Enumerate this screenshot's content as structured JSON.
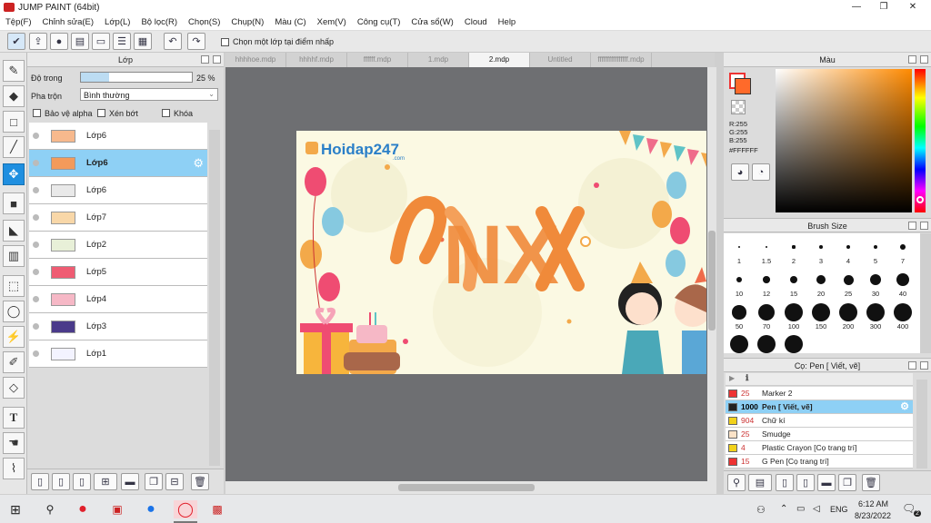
{
  "window": {
    "title": "JUMP PAINT (64bit)",
    "minimize": "—",
    "restore": "❐",
    "close": "✕"
  },
  "menu": [
    "Tệp(F)",
    "Chỉnh sửa(E)",
    "Lớp(L)",
    "Bộ lọc(R)",
    "Chọn(S)",
    "Chụp(N)",
    "Màu (C)",
    "Xem(V)",
    "Công cụ(T)",
    "Cửa sổ(W)",
    "Cloud",
    "Help"
  ],
  "toolbar": {
    "select_layer_label": "Chọn một lớp tại điểm nhấp"
  },
  "layers_panel": {
    "title": "Lớp",
    "opacity_label": "Độ trong",
    "opacity_value": "25 %",
    "opacity_fraction": 0.25,
    "blend_label": "Pha trộn",
    "blend_value": "Bình thường",
    "protect_alpha": "Bảo vệ alpha",
    "clip": "Xén bớt",
    "lock": "Khóa",
    "layers": [
      {
        "name": "Lớp6",
        "thumb": "#f7b98d"
      },
      {
        "name": "Lớp6",
        "thumb": "#f39a5a",
        "selected": true
      },
      {
        "name": "Lớp6",
        "thumb": "#e9e9e9"
      },
      {
        "name": "Lớp7",
        "thumb": "#f8d7a8"
      },
      {
        "name": "Lớp2",
        "thumb": "#e8f0d8"
      },
      {
        "name": "Lớp5",
        "thumb": "#ef5c73"
      },
      {
        "name": "Lớp4",
        "thumb": "#f6b8c6"
      },
      {
        "name": "Lớp3",
        "thumb": "#4a3a8a"
      },
      {
        "name": "Lớp1",
        "thumb": "#f3f3ff"
      }
    ]
  },
  "tabs": [
    {
      "label": "hhhhoe.mdp"
    },
    {
      "label": "hhhhf.mdp"
    },
    {
      "label": "ffffff.mdp"
    },
    {
      "label": "1.mdp"
    },
    {
      "label": "2.mdp",
      "active": true
    },
    {
      "label": "Untitled"
    },
    {
      "label": "ffffffffffffffff.mdp"
    }
  ],
  "artwork": {
    "logo_text": "Hoidap247",
    "logo_sub": ".com",
    "main_text": "NX"
  },
  "color_panel": {
    "title": "Màu",
    "r": "R:255",
    "g": "G:255",
    "b": "B:255",
    "hex": "#FFFFFF",
    "primary": "#ff6a2a"
  },
  "brush_size": {
    "title": "Brush Size",
    "sizes": [
      "1",
      "1.5",
      "2",
      "3",
      "4",
      "5",
      "7",
      "10",
      "12",
      "15",
      "20",
      "25",
      "30",
      "40",
      "50",
      "70",
      "100",
      "150",
      "200",
      "300",
      "400"
    ]
  },
  "brush_panel": {
    "title": "Cọ: Pen [ Viết, vẽ]",
    "brushes": [
      {
        "size": "25",
        "name": "Marker 2",
        "color": "#e33"
      },
      {
        "size": "1000",
        "name": "Pen [ Viết, vẽ]",
        "color": "#222",
        "selected": true
      },
      {
        "size": "904",
        "name": "Chữ kí",
        "color": "#f2d21b"
      },
      {
        "size": "25",
        "name": "Smudge",
        "color": "#fbe3c8"
      },
      {
        "size": "4",
        "name": "Plastic Crayon [Cọ trang trí]",
        "color": "#f2d21b"
      },
      {
        "size": "15",
        "name": "G Pen [Cọ trang trí]",
        "color": "#e33"
      }
    ]
  },
  "taskbar": {
    "lang": "ENG",
    "time": "6:12 AM",
    "date": "8/23/2022",
    "notifications": "2"
  }
}
